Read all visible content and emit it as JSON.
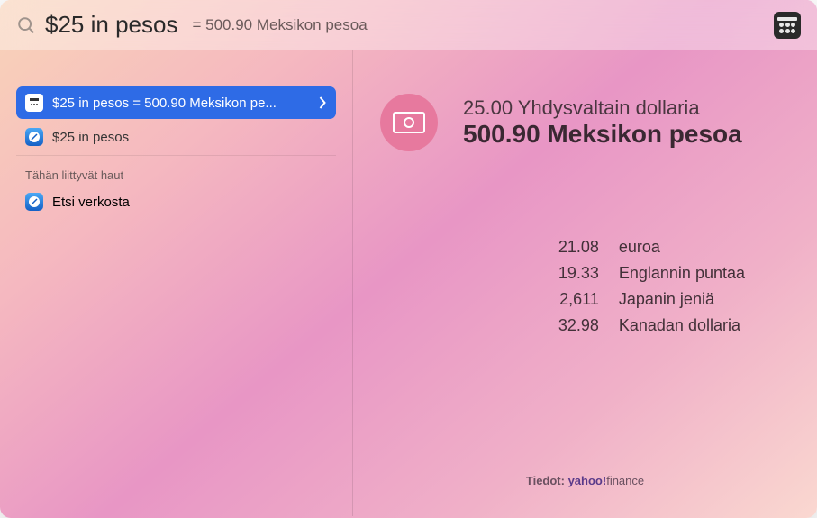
{
  "search": {
    "query": "$25 in pesos",
    "answer_prefix": "= ",
    "answer": "500.90 Meksikon pesoa"
  },
  "sidebar": {
    "items": [
      {
        "label": "$25 in pesos = 500.90 Meksikon pe...",
        "selected": true
      },
      {
        "label": "$25 in pesos",
        "selected": false
      }
    ],
    "related_header": "Tähän liittyvät haut",
    "related_item": "Etsi verkosta"
  },
  "detail": {
    "source_line": "25.00 Yhdysvaltain dollaria",
    "result_line": "500.90 Meksikon pesoa",
    "conversions": [
      {
        "value": "21.08",
        "label": "euroa"
      },
      {
        "value": "19.33",
        "label": "Englannin puntaa"
      },
      {
        "value": "2,611",
        "label": "Japanin jeniä"
      },
      {
        "value": "32.98",
        "label": "Kanadan dollaria"
      }
    ]
  },
  "footer": {
    "prefix": "Tiedot: ",
    "brand1": "yahoo!",
    "brand2": "finance"
  }
}
